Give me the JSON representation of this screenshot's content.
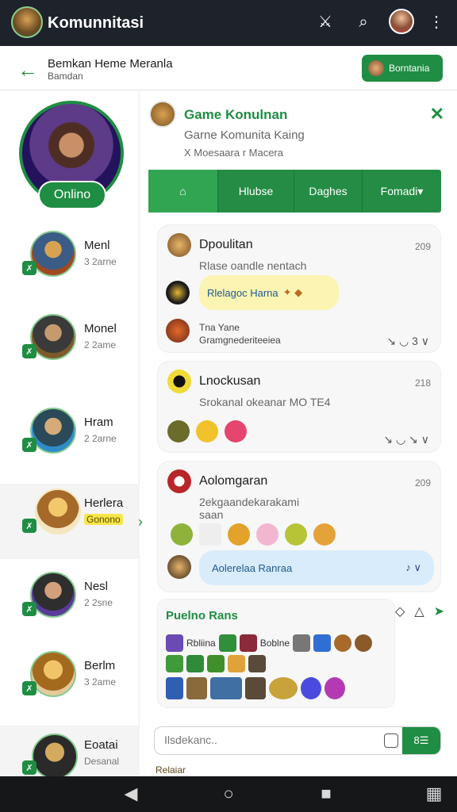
{
  "app": {
    "title": "Komunnitasi"
  },
  "topbar": {
    "icons": [
      "sword-icon",
      "search-icon",
      "user-avatar",
      "more-icon"
    ]
  },
  "subheader": {
    "title": "Bemkan Heme Meranla",
    "subtitle": "Bamdan",
    "join_label": "Borntania"
  },
  "sidebar": {
    "status": "Onlino",
    "members": [
      {
        "name": "Menl",
        "sub": "3 2arne"
      },
      {
        "name": "Monel",
        "sub": "2 2ame"
      },
      {
        "name": "Hram",
        "sub": "2 2arne"
      },
      {
        "name": "Herlera",
        "sub": "Gonono"
      },
      {
        "name": "Nesl",
        "sub": "2 2sne"
      },
      {
        "name": "Berlm",
        "sub": "3 2ame"
      },
      {
        "name": "Eoatai",
        "sub": "Desanal"
      }
    ]
  },
  "group": {
    "title": "Game Konulnan",
    "description": "Garne Komunita Kaing",
    "meta": "X Moesaara r Macera"
  },
  "tabs": [
    {
      "label": "home-icon"
    },
    {
      "label": "Hlubse"
    },
    {
      "label": "Daghes"
    },
    {
      "label": "Fomadi"
    }
  ],
  "posts": [
    {
      "title": "Dpoulitan",
      "time": "209",
      "body": "Rlase oandle nentach",
      "bubble": "Rlelagoc Harna",
      "reply_author": "Tna Yane",
      "reply_body": "Gramgnederiteeiea",
      "actions": "↘ ◡ 3 ∨"
    },
    {
      "title": "Lnockusan",
      "time": "218",
      "body": "Srokanal okeanar MO TE4",
      "actions": "↘ ◡ ↘ ∨"
    },
    {
      "title": "Aolomgaran",
      "time": "209",
      "body": "2ekgaandekarakami",
      "body2": "saan",
      "reply_label": "Aolerelaa Ranraa"
    }
  ],
  "gallery": {
    "title": "Puelno Rans",
    "row1": [
      "Rbliina",
      "Boblne"
    ]
  },
  "composer": {
    "placeholder": "Ilsdekanc..",
    "send_label": "8☰"
  },
  "footnote": "Relaiar",
  "colors": {
    "primary": "#1f8d43",
    "topbar": "#1d222b",
    "accent_yellow": "#f6e548"
  }
}
